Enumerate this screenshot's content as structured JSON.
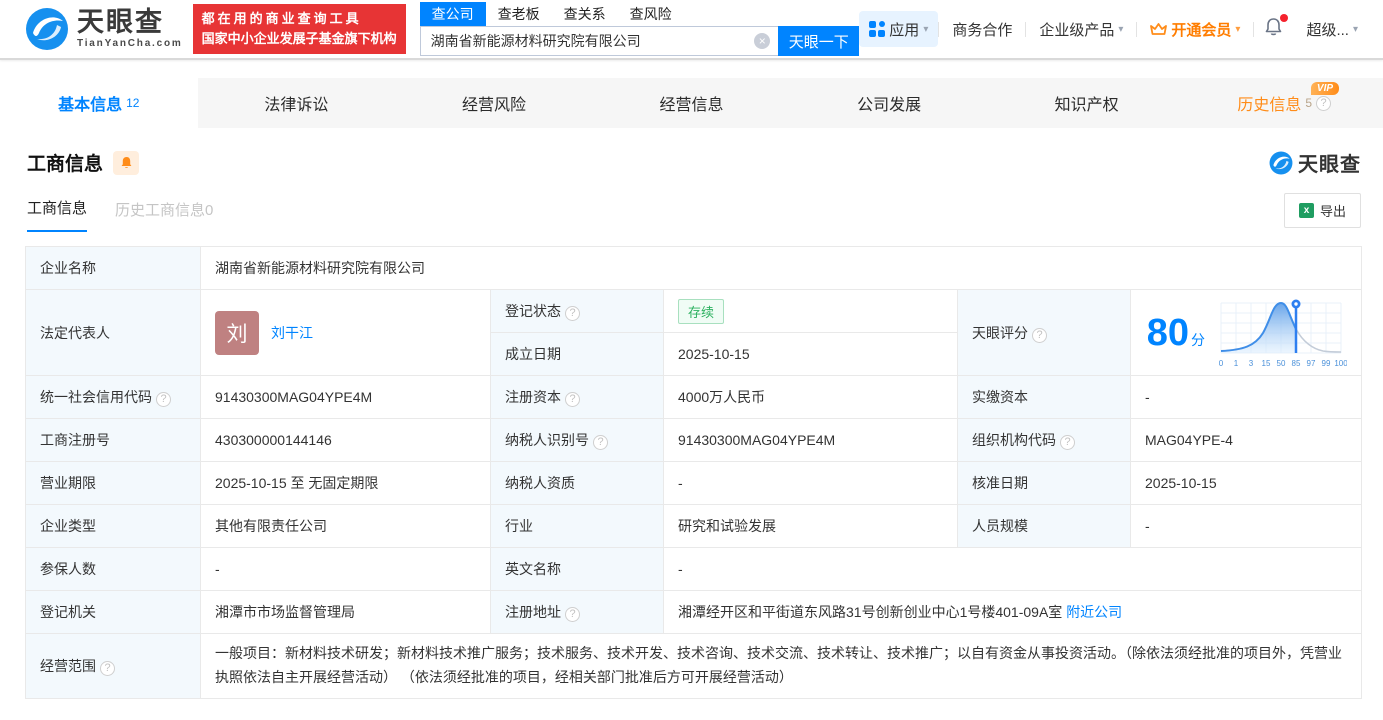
{
  "brand": {
    "logo_text": "天眼查",
    "logo_domain": "TianYanCha.com",
    "slogan_line1": "都在用的商业查询工具",
    "slogan_line2": "国家中小企业发展子基金旗下机构"
  },
  "search": {
    "tabs": [
      {
        "label": "查公司",
        "active": true
      },
      {
        "label": "查老板",
        "active": false
      },
      {
        "label": "查关系",
        "active": false
      },
      {
        "label": "查风险",
        "active": false
      }
    ],
    "query": "湖南省新能源材料研究院有限公司",
    "button_label": "天眼一下"
  },
  "top_nav": {
    "apps_label": "应用",
    "coop_label": "商务合作",
    "enterprise_label": "企业级产品",
    "vip_label": "开通会员",
    "super_label": "超级..."
  },
  "icons": {
    "help_glyph": "?",
    "clear_glyph": "×",
    "caret_glyph": "▾",
    "excel_glyph": "x"
  },
  "page_tabs": [
    {
      "label": "基本信息",
      "count": "12"
    },
    {
      "label": "法律诉讼",
      "count": ""
    },
    {
      "label": "经营风险",
      "count": ""
    },
    {
      "label": "经营信息",
      "count": ""
    },
    {
      "label": "公司发展",
      "count": ""
    },
    {
      "label": "知识产权",
      "count": ""
    },
    {
      "label": "历史信息",
      "count": "5",
      "vip_badge": "VIP"
    }
  ],
  "section": {
    "title": "工商信息",
    "watermark_text": "天眼查",
    "subtabs": [
      {
        "label": "工商信息",
        "count": ""
      },
      {
        "label": "历史工商信息",
        "count": "0"
      }
    ],
    "export_label": "导出"
  },
  "table": {
    "company_name_label": "企业名称",
    "company_name": "湖南省新能源材料研究院有限公司",
    "legal_rep_label": "法定代表人",
    "legal_rep_avatar": "刘",
    "legal_rep_name": "刘干江",
    "reg_status_label": "登记状态",
    "reg_status": "存续",
    "est_date_label": "成立日期",
    "est_date": "2025-10-15",
    "score_label": "天眼评分",
    "score_value": "80",
    "score_unit": "分",
    "score_axis": [
      "0",
      "1",
      "3",
      "15",
      "50",
      "85",
      "97",
      "99",
      "100"
    ],
    "uscc_label": "统一社会信用代码",
    "uscc": "91430300MAG04YPE4M",
    "reg_capital_label": "注册资本",
    "reg_capital": "4000万人民币",
    "paid_capital_label": "实缴资本",
    "paid_capital": "-",
    "reg_number_label": "工商注册号",
    "reg_number": "430300000144146",
    "taxpayer_id_label": "纳税人识别号",
    "taxpayer_id": "91430300MAG04YPE4M",
    "org_code_label": "组织机构代码",
    "org_code": "MAG04YPE-4",
    "business_term_label": "营业期限",
    "business_term": "2025-10-15 至 无固定期限",
    "taxpayer_quality_label": "纳税人资质",
    "taxpayer_quality": "-",
    "approval_date_label": "核准日期",
    "approval_date": "2025-10-15",
    "company_type_label": "企业类型",
    "company_type": "其他有限责任公司",
    "industry_label": "行业",
    "industry": "研究和试验发展",
    "staff_size_label": "人员规模",
    "staff_size": "-",
    "insured_label": "参保人数",
    "insured": "-",
    "english_name_label": "英文名称",
    "english_name": "-",
    "reg_authority_label": "登记机关",
    "reg_authority": "湘潭市市场监督管理局",
    "address_label": "注册地址",
    "address": "湘潭经开区和平街道东风路31号创新创业中心1号楼401-09A室",
    "nearby_link": "附近公司",
    "business_scope_label": "经营范围",
    "business_scope": "一般项目：新材料技术研发；新材料技术推广服务；技术服务、技术开发、技术咨询、技术交流、技术转让、技术推广；以自有资金从事投资活动。（除依法须经批准的项目外，凭营业执照依法自主开展经营活动） （依法须经批准的项目，经相关部门批准后方可开展经营活动）"
  },
  "colors": {
    "accent_blue": "#0084ff",
    "brand_red": "#e73435",
    "vip_orange": "#ff8c19",
    "status_green": "#2bb05f",
    "avatar_rose": "#bf8181",
    "label_cell_bg": "#f3f9fd"
  }
}
